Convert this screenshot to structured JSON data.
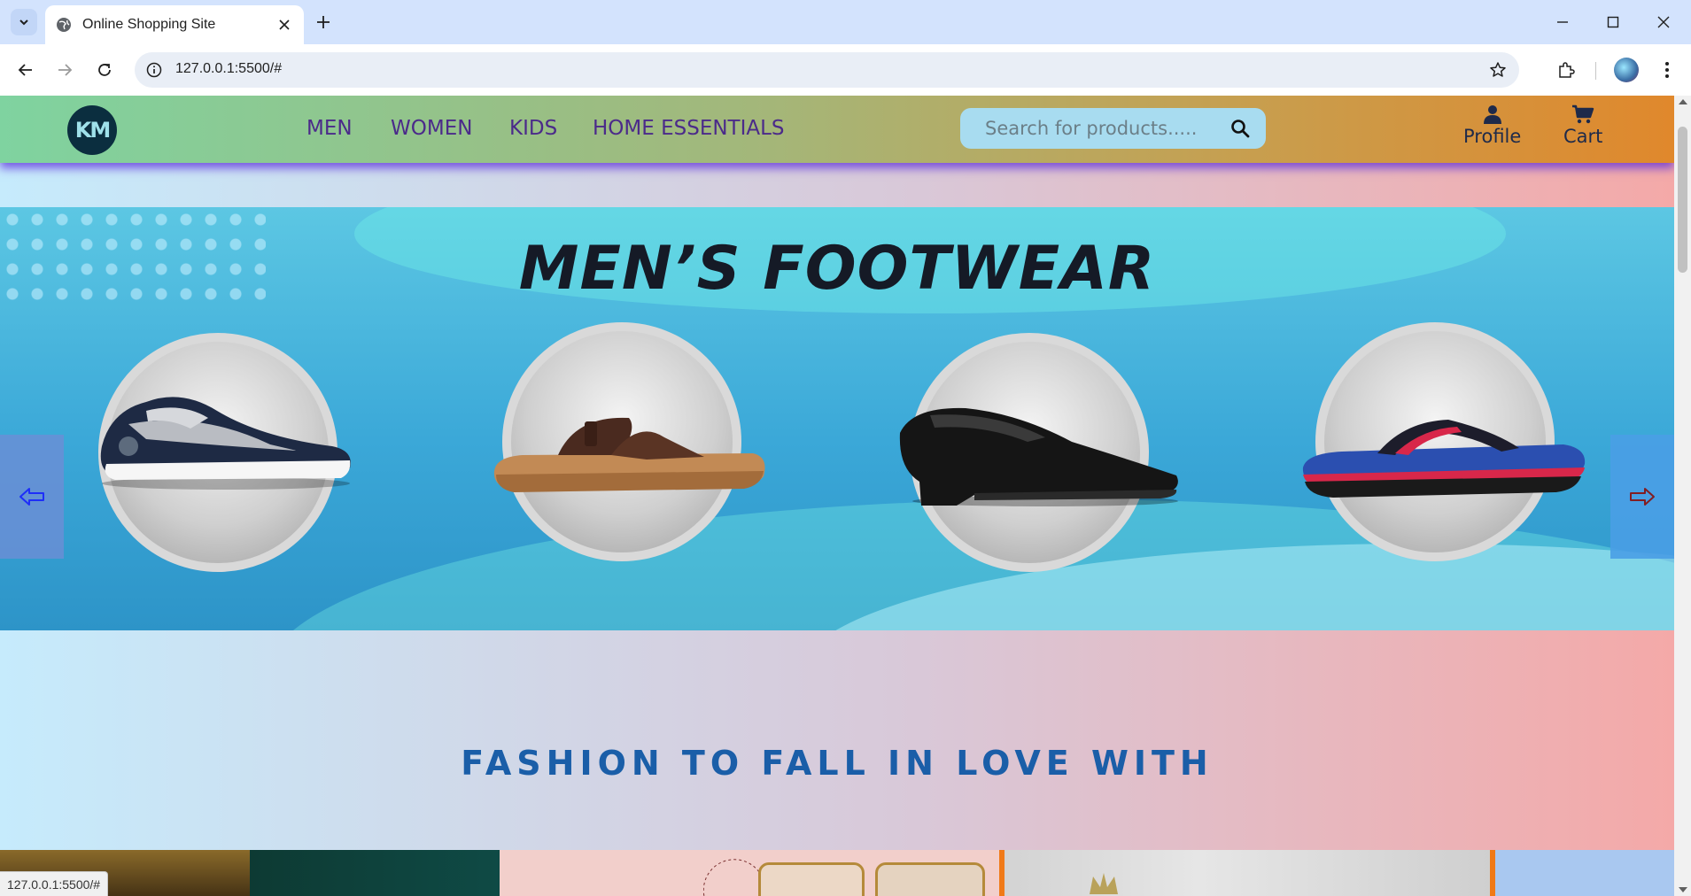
{
  "browser": {
    "tab_title": "Online Shopping Site",
    "url": "127.0.0.1:5500/#",
    "status_url": "127.0.0.1:5500/#"
  },
  "site": {
    "logo_text": "KM",
    "nav": [
      "MEN",
      "WOMEN",
      "KIDS",
      "HOME ESSENTIALS"
    ],
    "search_placeholder": "Search for products.....",
    "profile_label": "Profile",
    "cart_label": "Cart"
  },
  "banner": {
    "title": "MEN’S FOOTWEAR",
    "products": [
      "sneaker",
      "sandal",
      "formal-shoe",
      "flip-flop"
    ],
    "prev_arrow": "⇦",
    "next_arrow": "⇨"
  },
  "section": {
    "title": "FASHION TO FALL IN LOVE WITH"
  },
  "colors": {
    "nav_text": "#4b2a8a",
    "section_title": "#1a5ea8",
    "header_shadow": "#5a28dc"
  }
}
